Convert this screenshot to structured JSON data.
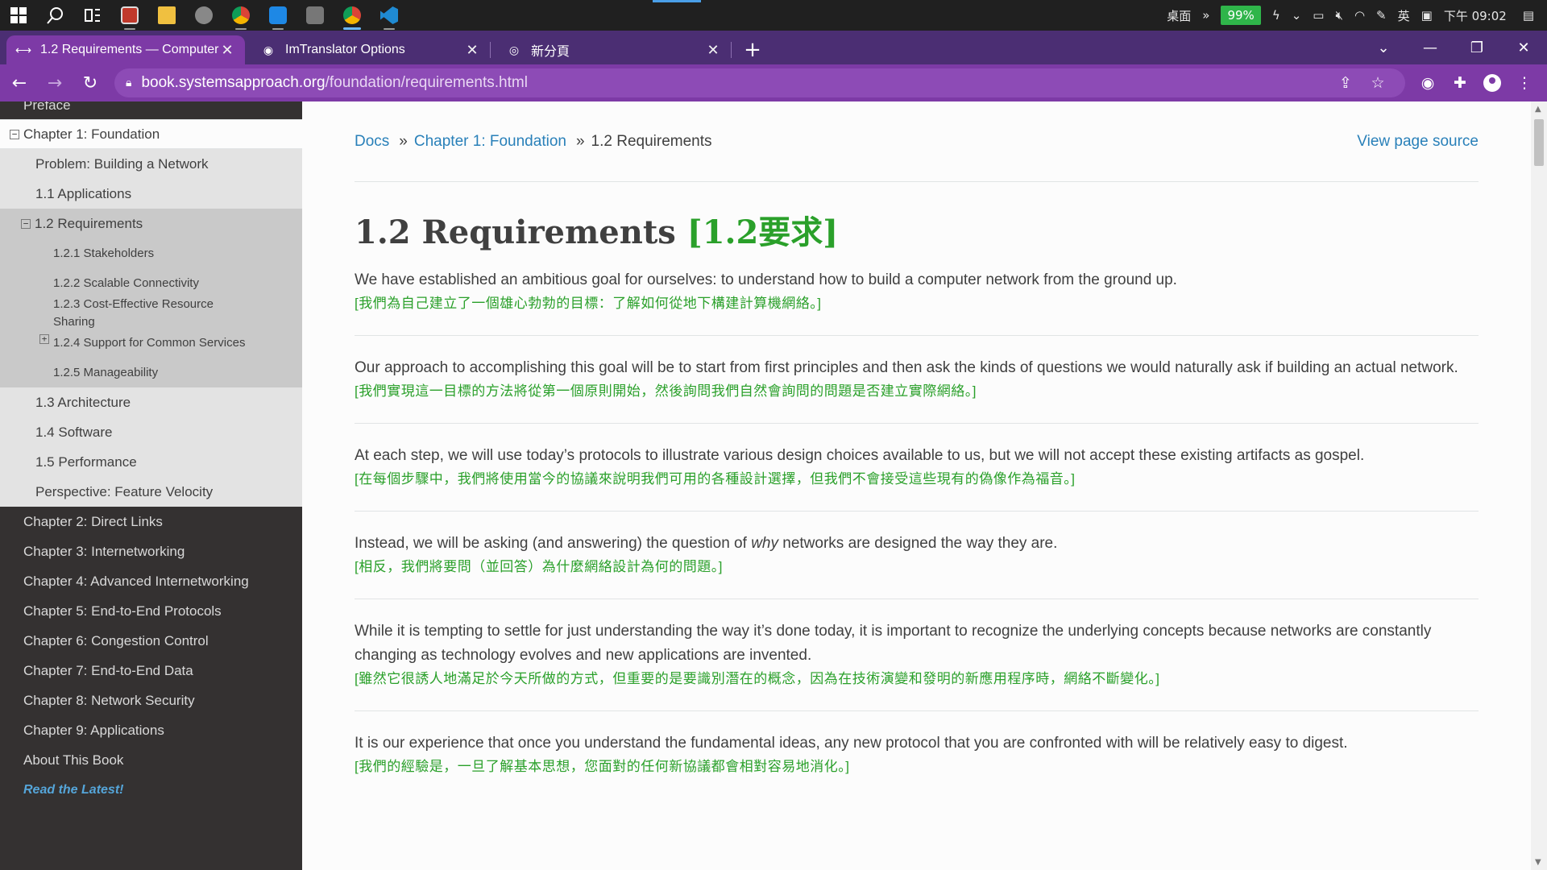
{
  "taskbar": {
    "ime_desktop": "桌面",
    "battery": "99%",
    "ime_lang": "英",
    "clock": "下午 09:02"
  },
  "tabs": [
    {
      "title": "1.2 Requirements — Computer",
      "close": "✕"
    },
    {
      "title": "ImTranslator Options",
      "close": "✕"
    },
    {
      "title": "新分頁",
      "close": "✕"
    }
  ],
  "toolbar": {
    "url_host": "book.systemsapproach.org",
    "url_path": "/foundation/requirements.html"
  },
  "sidebar": {
    "preface": "Preface",
    "current_chapter": "Chapter 1: Foundation",
    "level2": [
      "Problem: Building a Network",
      "1.1 Applications"
    ],
    "open_section": "1.2 Requirements",
    "level3": [
      "1.2.1 Stakeholders",
      "1.2.2 Scalable Connectivity",
      "1.2.3 Cost-Effective Resource Sharing",
      "1.2.4 Support for Common Services",
      "1.2.5 Manageability"
    ],
    "level2_after": [
      "1.3 Architecture",
      "1.4 Software",
      "1.5 Performance",
      "Perspective: Feature Velocity"
    ],
    "chapters": [
      "Chapter 2: Direct Links",
      "Chapter 3: Internetworking",
      "Chapter 4: Advanced Internetworking",
      "Chapter 5: End-to-End Protocols",
      "Chapter 6: Congestion Control",
      "Chapter 7: End-to-End Data",
      "Chapter 8: Network Security",
      "Chapter 9: Applications",
      "About This Book"
    ],
    "read_latest": "Read the Latest!"
  },
  "breadcrumbs": {
    "docs": "Docs",
    "sep": "»",
    "chapter": "Chapter 1: Foundation",
    "current": "1.2 Requirements",
    "source": "View page source"
  },
  "page": {
    "title": "1.2 Requirements",
    "title_translation": "[1.2要求]",
    "paragraphs": [
      {
        "text": "We have established an ambitious goal for ourselves: to understand how to build a computer network from the ground up.",
        "translation": "[我們為自己建立了一個雄心勃勃的目標：了解如何從地下構建計算機網絡。]"
      },
      {
        "text": "Our approach to accomplishing this goal will be to start from first principles and then ask the kinds of questions we would naturally ask if building an actual network.",
        "translation": "[我們實現這一目標的方法將從第一個原則開始，然後詢問我們自然會詢問的問題是否建立實際網絡。]"
      },
      {
        "text": "At each step, we will use today’s protocols to illustrate various design choices available to us, but we will not accept these existing artifacts as gospel.",
        "translation": "[在每個步驟中，我們將使用當今的協議來說明我們可用的各種設計選擇，但我們不會接受這些現有的偽像作為福音。]"
      },
      {
        "text_before": "Instead, we will be asking (and answering) the question of ",
        "text_em": "why",
        "text_after": " networks are designed the way they are.",
        "translation": "[相反，我們將要問（並回答）為什麼網絡設計為何的問題。]"
      },
      {
        "text": "While it is tempting to settle for just understanding the way it’s done today, it is important to recognize the underlying concepts because networks are constantly changing as technology evolves and new applications are invented.",
        "translation": "[雖然它很誘人地滿足於今天所做的方式，但重要的是要識別潛在的概念，因為在技術演變和發明的新應用程序時，網絡不斷變化。]"
      },
      {
        "text": "It is our experience that once you understand the fundamental ideas, any new protocol that you are confronted with will be relatively easy to digest.",
        "translation": "[我們的經驗是，一旦了解基本思想，您面對的任何新協議都會相對容易地消化。]"
      }
    ]
  },
  "colors": {
    "tabstrip": "#4b2e73",
    "toolbar": "#7d3aa6",
    "sidebar_dark": "#343131",
    "link": "#2980b9",
    "translation": "#2aa02a"
  }
}
